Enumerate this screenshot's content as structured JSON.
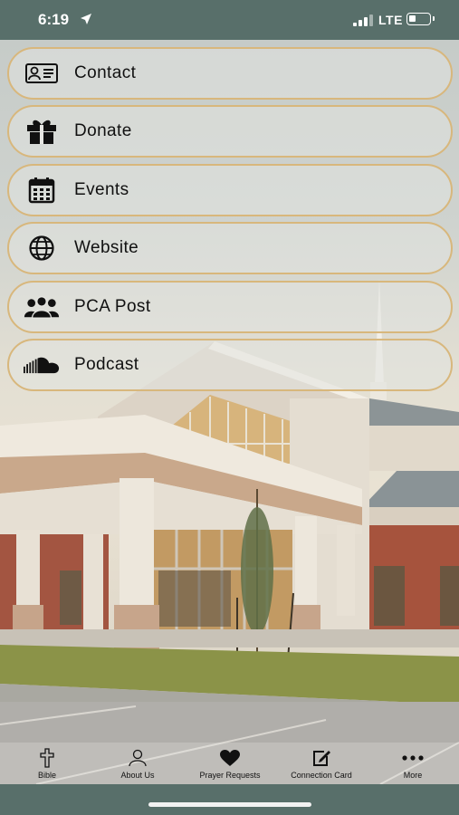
{
  "status_bar": {
    "time": "6:19",
    "network": "LTE"
  },
  "menu": {
    "items": [
      {
        "label": "Contact",
        "icon": "contact-card-icon"
      },
      {
        "label": "Donate",
        "icon": "gift-icon"
      },
      {
        "label": "Events",
        "icon": "calendar-icon"
      },
      {
        "label": "Website",
        "icon": "globe-icon"
      },
      {
        "label": "PCA Post",
        "icon": "people-group-icon"
      },
      {
        "label": "Podcast",
        "icon": "soundcloud-icon"
      }
    ]
  },
  "tab_bar": {
    "items": [
      {
        "label": "Bible",
        "icon": "cross-icon"
      },
      {
        "label": "About Us",
        "icon": "person-icon"
      },
      {
        "label": "Prayer Requests",
        "icon": "heart-icon"
      },
      {
        "label": "Connection Card",
        "icon": "edit-icon"
      },
      {
        "label": "More",
        "icon": "more-dots-icon"
      }
    ]
  },
  "colors": {
    "chrome": "#586f6a",
    "button_border": "#d8b77c",
    "text": "#111111"
  }
}
